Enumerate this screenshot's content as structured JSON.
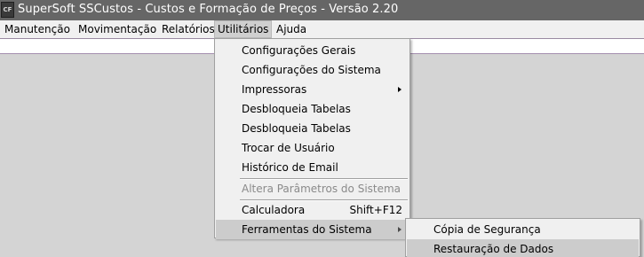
{
  "window": {
    "title": "SuperSoft SSCustos - Custos e Formação de Preços - Versão 2.20",
    "icon_label": "CF",
    "icon_name": "app-icon"
  },
  "menubar": {
    "items": [
      {
        "label": "Manutenção"
      },
      {
        "label": "Movimentação"
      },
      {
        "label": "Relatórios"
      },
      {
        "label": "Utilitários",
        "active": true
      },
      {
        "label": "Ajuda"
      }
    ]
  },
  "utilitarios_menu": {
    "items": [
      {
        "label": "Configurações Gerais"
      },
      {
        "label": "Configurações do Sistema"
      },
      {
        "label": "Impressoras",
        "submenu_icon": "chevron-right-icon"
      },
      {
        "label": "Desbloqueia Tabelas"
      },
      {
        "label": "Desbloqueia Tabelas"
      },
      {
        "label": "Trocar de Usuário"
      },
      {
        "label": "Histórico de Email"
      },
      {
        "label": "Altera Parâmetros do Sistema",
        "disabled": true
      },
      {
        "label": "Calculadora",
        "shortcut": "Shift+F12"
      },
      {
        "label": "Ferramentas do Sistema",
        "submenu_icon": "chevron-right-icon",
        "highlighted": true
      }
    ]
  },
  "ferramentas_submenu": {
    "items": [
      {
        "label": "Cópia de Segurança"
      },
      {
        "label": "Restauração de Dados",
        "highlighted": true
      }
    ]
  },
  "colors": {
    "titlebar": "#666666",
    "menubar": "#f0f0f0",
    "highlight": "#cccccc",
    "disabled_text": "#8a8a8a"
  }
}
